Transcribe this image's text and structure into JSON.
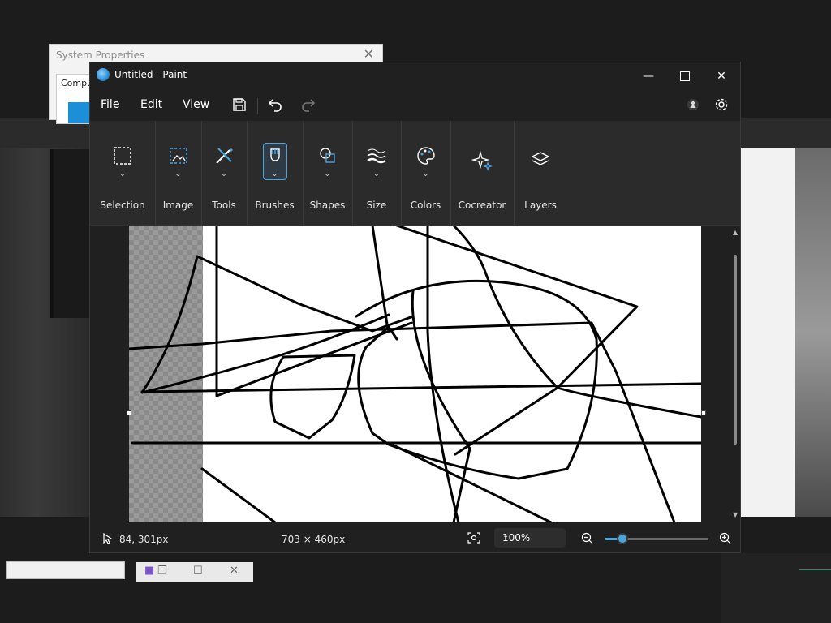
{
  "background": {
    "system_properties": {
      "title": "System Properties",
      "tab_label": "Comput"
    }
  },
  "window": {
    "title": "Untitled - Paint",
    "controls": {
      "minimize": "—",
      "close": "✕"
    }
  },
  "menubar": {
    "file": "File",
    "edit": "Edit",
    "view": "View"
  },
  "ribbon": {
    "groups": [
      {
        "label": "Selection",
        "icon": "selection-icon"
      },
      {
        "label": "Image",
        "icon": "image-icon"
      },
      {
        "label": "Tools",
        "icon": "tools-icon"
      },
      {
        "label": "Brushes",
        "icon": "brushes-icon",
        "selected": true
      },
      {
        "label": "Shapes",
        "icon": "shapes-icon"
      },
      {
        "label": "Size",
        "icon": "size-icon"
      },
      {
        "label": "Colors",
        "icon": "colors-icon"
      },
      {
        "label": "Cocreator",
        "icon": "cocreator-icon"
      },
      {
        "label": "Layers",
        "icon": "layers-icon"
      }
    ]
  },
  "status": {
    "cursor_position": "84, 301px",
    "canvas_size": "703 × 460px",
    "zoom": "100%",
    "zoom_slider_fraction": 0.17
  },
  "colors": {
    "accent": "#4aa6e0",
    "window_bg": "#202020",
    "ribbon_bg": "#2b2b2b",
    "canvas": "#ffffff"
  }
}
